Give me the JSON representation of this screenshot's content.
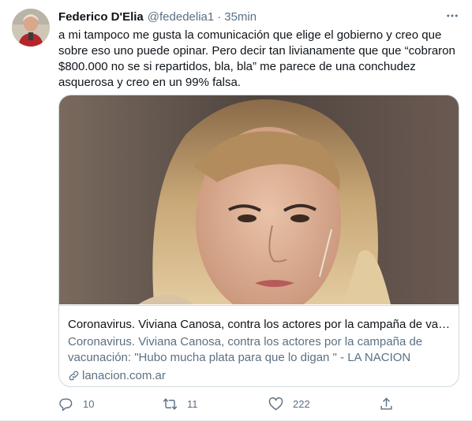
{
  "tweet": {
    "author_name": "Federico D'Elia",
    "author_handle": "@fededelia1",
    "separator": "·",
    "time": "35min",
    "text_lines": [
      "a mi tampoco me gusta la comunicación que elige el gobierno y creo que",
      "sobre eso uno puede opinar. Pero decir tan livianamente que que “cobraron",
      "$800.000 no se si repartidos, bla, bla” me parece de una conchudez",
      "asquerosa y creo en un 99% falsa."
    ]
  },
  "card": {
    "title": "Coronavirus. Viviana Canosa, contra los actores por la campaña de vacunación: \"Hubo mucha plata para que lo digan \" - LA NACION",
    "description": "Coronavirus. Viviana Canosa, contra los actores por la campaña de vacunación: \"Hubo mucha plata para que lo digan \" - LA NACION",
    "domain": "lanacion.com.ar"
  },
  "actions": {
    "replies": "10",
    "retweets": "11",
    "likes": "222"
  },
  "icons": {
    "more": "more-icon",
    "reply": "reply-icon",
    "retweet": "retweet-icon",
    "like": "heart-icon",
    "share": "share-icon",
    "link": "link-icon"
  },
  "colors": {
    "text": "#0f1419",
    "secondary": "#5b7083",
    "border": "#cfd9de"
  }
}
